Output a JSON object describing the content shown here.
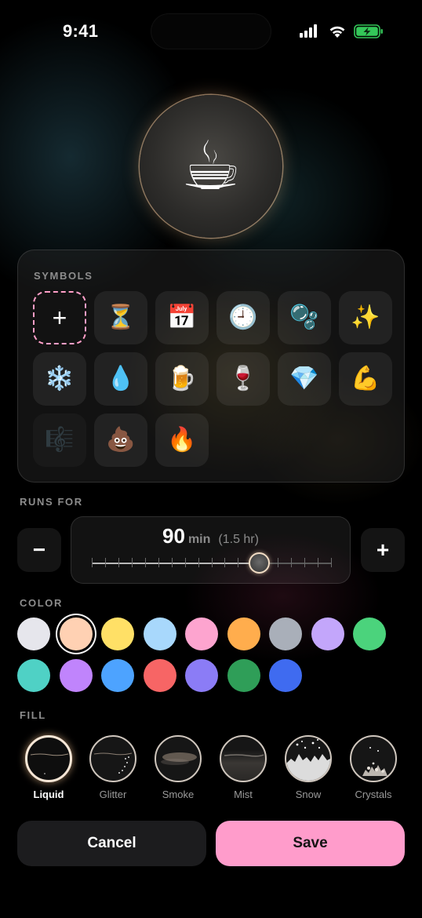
{
  "status_bar": {
    "time": "9:41"
  },
  "hero": {
    "symbol": "☕"
  },
  "symbols": {
    "label": "SYMBOLS",
    "add_label": "+",
    "items": [
      "⏳",
      "📅",
      "🕘",
      "🫧",
      "✨",
      "❄️",
      "💧",
      "🍺",
      "🍷",
      "💎",
      "💪",
      "🎼",
      "💩",
      "🔥"
    ]
  },
  "runs_for": {
    "label": "RUNS FOR",
    "value": "90",
    "unit": "min",
    "hours": "(1.5 hr)",
    "minus_label": "−",
    "plus_label": "+",
    "slider_fraction": 0.7
  },
  "color": {
    "label": "COLOR",
    "selected_index": 1,
    "swatches": [
      "#e6e6ec",
      "#ffd1b3",
      "#ffe066",
      "#a8d8fc",
      "#fda4cf",
      "#ffad4d",
      "#a9afb9",
      "#c3a6fb",
      "#4bd37c",
      "#4fd1c5",
      "#c084fc",
      "#4da3ff",
      "#f76565",
      "#8b7cf6",
      "#2f9e58",
      "#3f6bf0"
    ]
  },
  "fill": {
    "label": "FILL",
    "selected_index": 0,
    "options": [
      "Liquid",
      "Glitter",
      "Smoke",
      "Mist",
      "Snow",
      "Crystals"
    ]
  },
  "actions": {
    "cancel": "Cancel",
    "save": "Save"
  },
  "colors": {
    "accent_pink": "#ff9ccb",
    "battery_green": "#34c759"
  }
}
